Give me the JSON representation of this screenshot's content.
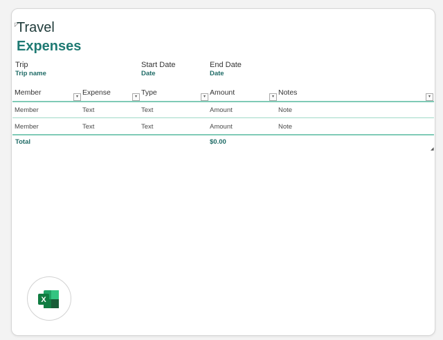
{
  "header": {
    "title_line1": "Travel",
    "title_line2": "Expenses"
  },
  "trip": {
    "trip_label": "Trip",
    "trip_value": "Trip name",
    "start_label": "Start Date",
    "start_value": "Date",
    "end_label": "End Date",
    "end_value": "Date"
  },
  "table": {
    "columns": [
      "Member",
      "Expense",
      "Type",
      "Amount",
      "Notes"
    ],
    "filter_glyph": "▾",
    "rows": [
      [
        "Member",
        "Text",
        "Text",
        "Amount",
        "Note"
      ],
      [
        "Member",
        "Text",
        "Text",
        "Amount",
        "Note"
      ]
    ],
    "total_label": "Total",
    "total_value": "$0.00"
  },
  "app": {
    "icon": "excel-icon",
    "letter": "X",
    "brand_color": "#107c41",
    "accent_color": "#1f7a73"
  }
}
